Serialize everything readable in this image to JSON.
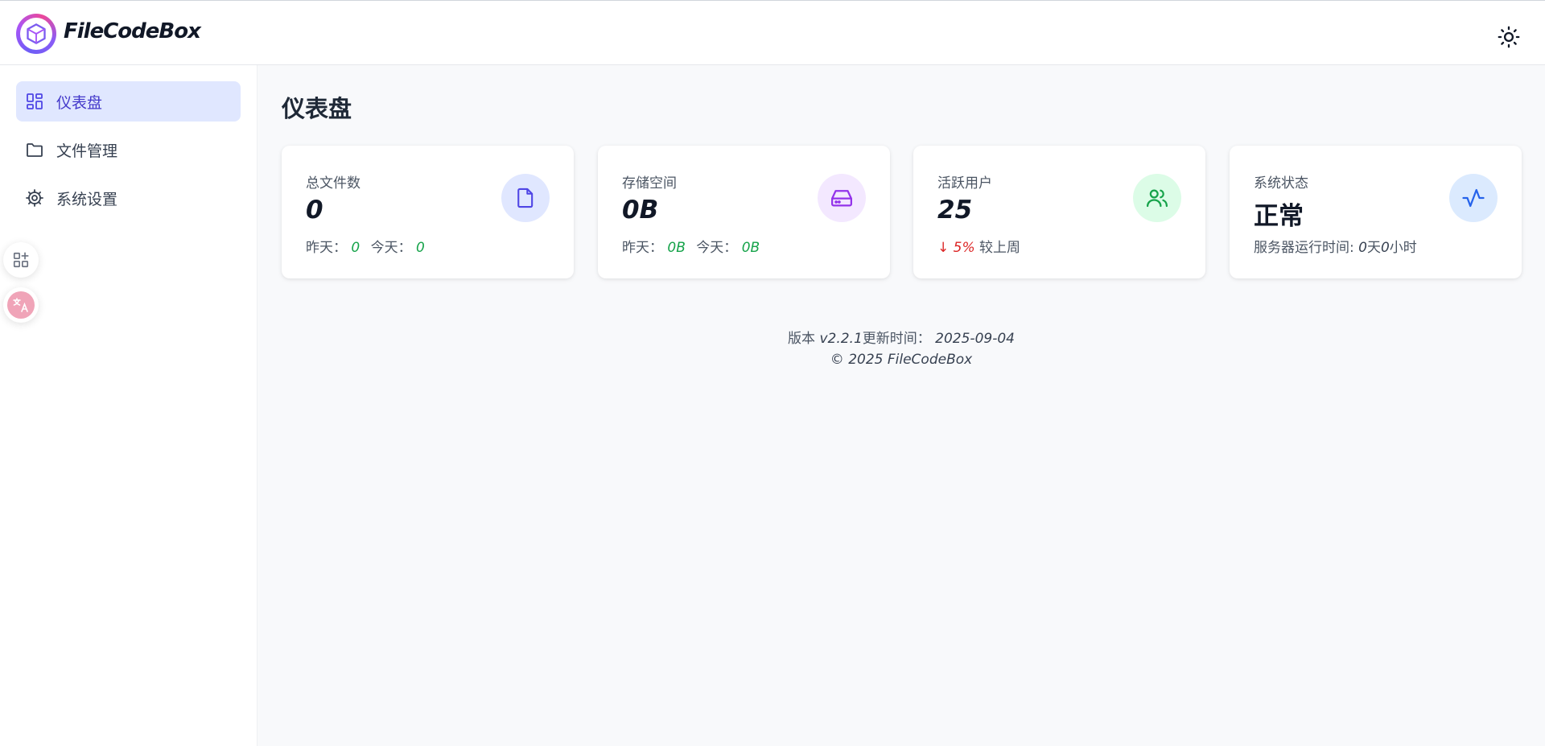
{
  "header": {
    "brand": "FileCodeBox",
    "theme_toggle_icon": "sun-icon"
  },
  "sidebar": {
    "items": [
      {
        "label": "仪表盘",
        "icon": "dashboard-icon",
        "active": true
      },
      {
        "label": "文件管理",
        "icon": "folder-icon",
        "active": false
      },
      {
        "label": "系统设置",
        "icon": "gear-icon",
        "active": false
      }
    ],
    "floating": [
      {
        "icon": "apps-add-icon"
      },
      {
        "icon": "translate-icon"
      }
    ]
  },
  "main": {
    "title": "仪表盘",
    "cards": [
      {
        "label": "总文件数",
        "value": "0",
        "sub_yesterday_label": "昨天：",
        "sub_yesterday_value": "0",
        "sub_today_label": "今天：",
        "sub_today_value": "0",
        "icon": "file-icon",
        "icon_color": "#4f46e5",
        "icon_bg": "#e0e7ff"
      },
      {
        "label": "存储空间",
        "value": "0B",
        "sub_yesterday_label": "昨天：",
        "sub_yesterday_value": "0B",
        "sub_today_label": "今天：",
        "sub_today_value": "0B",
        "icon": "hard-drive-icon",
        "icon_color": "#9333ea",
        "icon_bg": "#f3e8ff"
      },
      {
        "label": "活跃用户",
        "value": "25",
        "trend_arrow": "↓",
        "trend_value": "5%",
        "trend_text": "较上周",
        "icon": "users-icon",
        "icon_color": "#16a34a",
        "icon_bg": "#dcfce7"
      },
      {
        "label": "系统状态",
        "value": "正常",
        "uptime_label": "服务器运行时间:",
        "uptime_days": "0",
        "uptime_days_unit": "天",
        "uptime_hours": "0",
        "uptime_hours_unit": "小时",
        "icon": "activity-icon",
        "icon_color": "#2563eb",
        "icon_bg": "#dbeafe"
      }
    ]
  },
  "footer": {
    "version_label": "版本",
    "version": "v2.2.1",
    "updated_label": "更新时间：",
    "updated_date": "2025-09-04",
    "copyright": "© 2025 FileCodeBox"
  }
}
